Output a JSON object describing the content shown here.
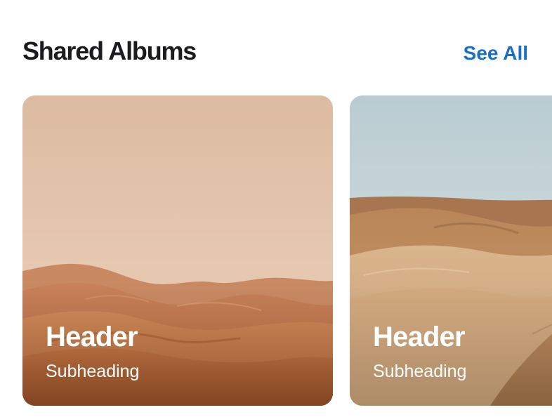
{
  "section": {
    "title": "Shared Albums",
    "see_all_label": "See All"
  },
  "albums": [
    {
      "header": "Header",
      "subheading": "Subheading"
    },
    {
      "header": "Header",
      "subheading": "Subheading"
    }
  ],
  "colors": {
    "accent": "#1a6fc4",
    "title": "#1c1c1e",
    "card_text": "#ffffff"
  }
}
